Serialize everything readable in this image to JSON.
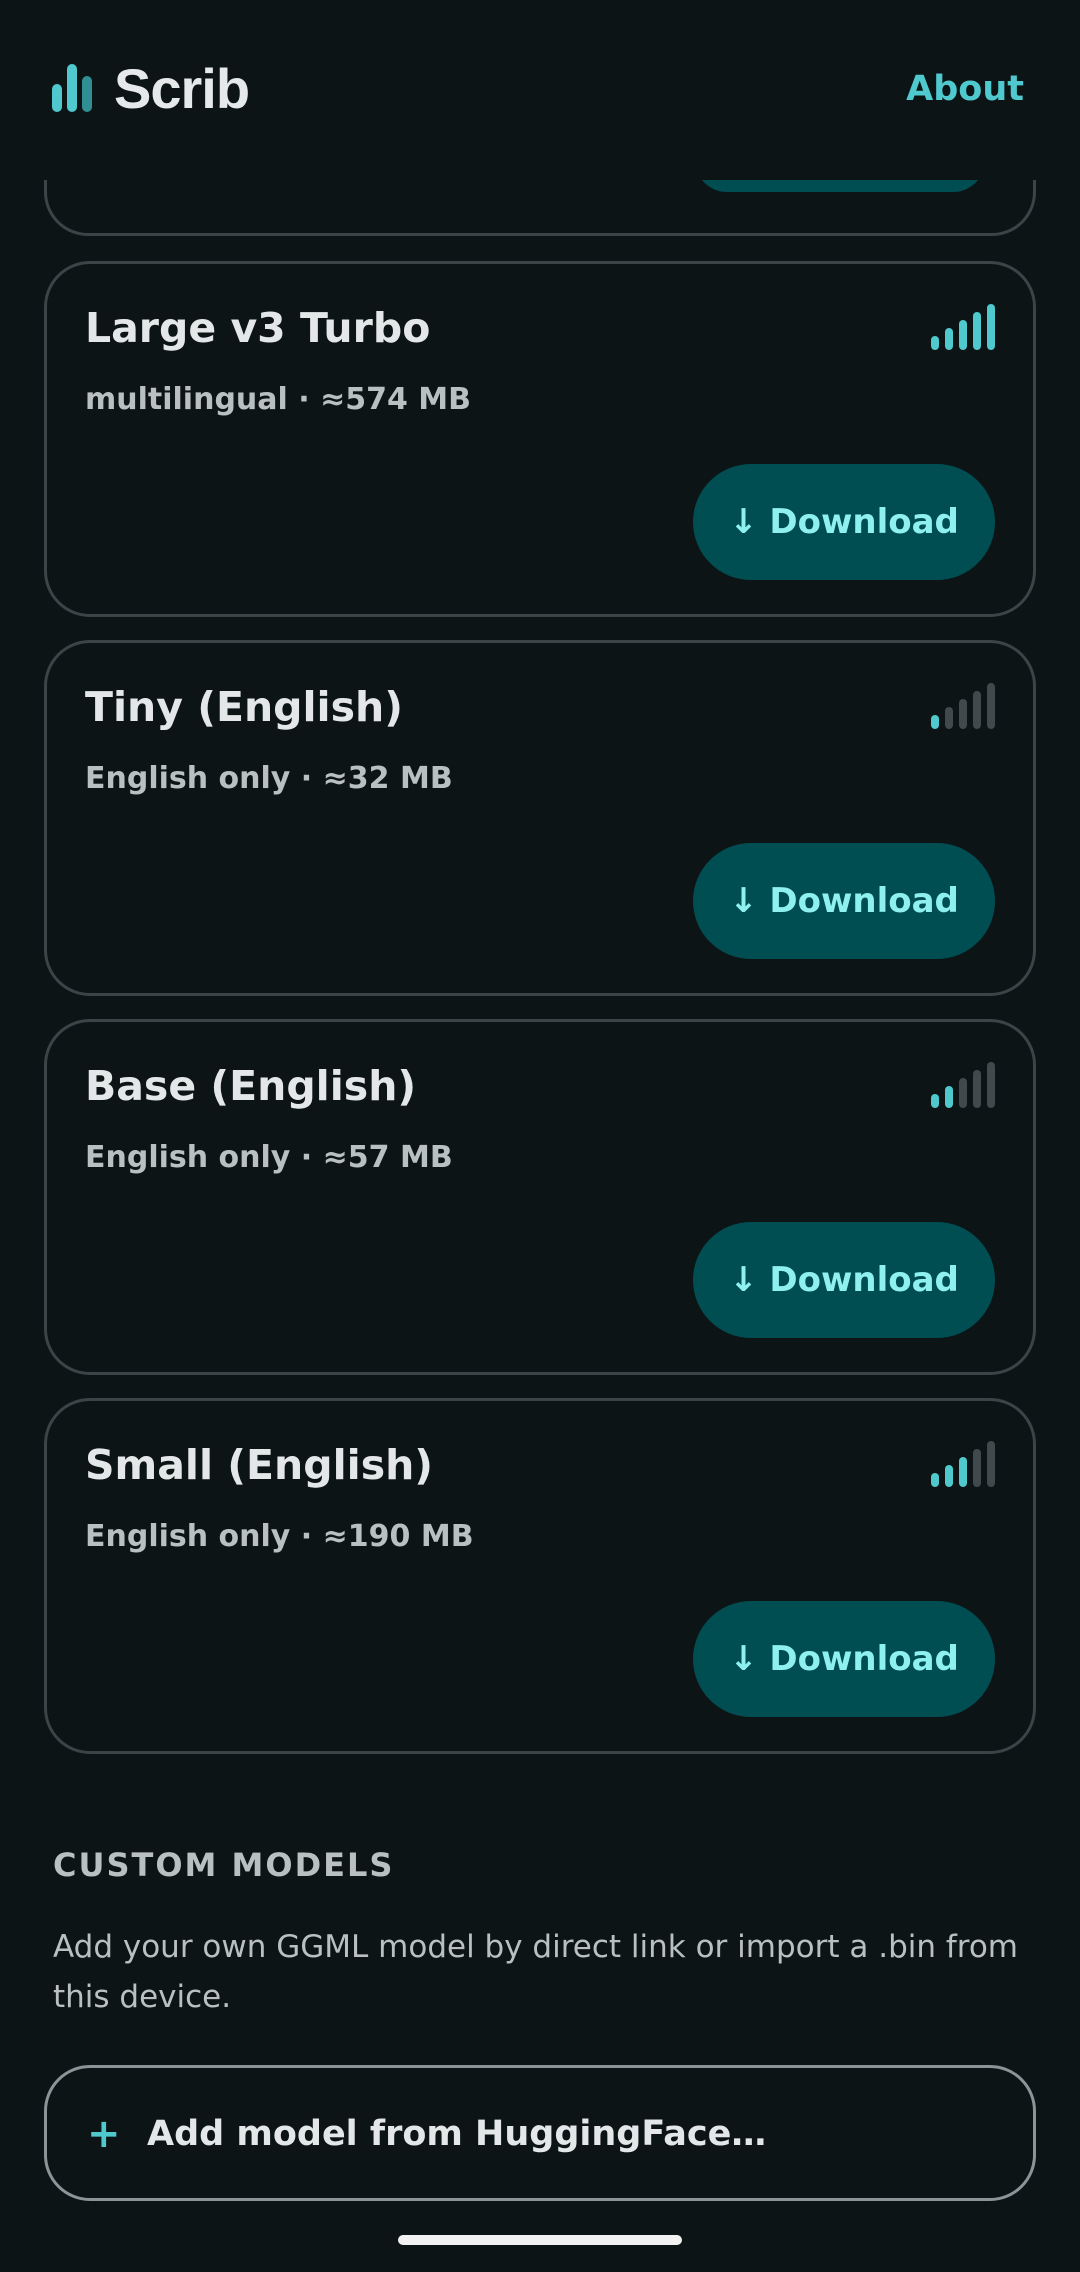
{
  "app": {
    "title": "Scrib",
    "about_label": "About"
  },
  "models": [
    {
      "name": "Large v3 Turbo",
      "meta": "multilingual · ≈574 MB",
      "quality_level": 5,
      "quality_max": 5,
      "button_label": "↓ Download"
    },
    {
      "name": "Tiny (English)",
      "meta": "English only · ≈32 MB",
      "quality_level": 1,
      "quality_max": 5,
      "button_label": "↓ Download"
    },
    {
      "name": "Base (English)",
      "meta": "English only · ≈57 MB",
      "quality_level": 2,
      "quality_max": 5,
      "button_label": "↓ Download"
    },
    {
      "name": "Small (English)",
      "meta": "English only · ≈190 MB",
      "quality_level": 3,
      "quality_max": 5,
      "button_label": "↓ Download"
    }
  ],
  "custom_models": {
    "header": "CUSTOM MODELS",
    "description": "Add your own GGML model by direct link or import a .bin from this device.",
    "add_icon": "+",
    "add_label": "Add model from HuggingFace…"
  },
  "colors": {
    "background": "#0d1416",
    "accent": "#4fc9ce",
    "button_bg": "#004e51",
    "button_text": "#8ff0f0"
  }
}
